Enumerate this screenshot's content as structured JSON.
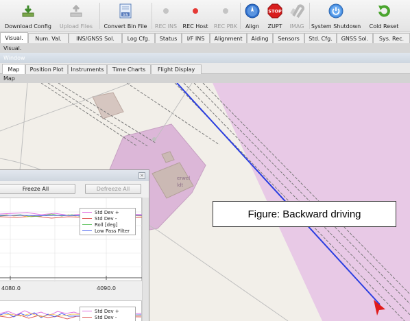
{
  "toolbar": {
    "buttons": [
      {
        "label": "Download Config",
        "icon": "download-icon",
        "enabled": true
      },
      {
        "label": "Upload Files",
        "icon": "upload-icon",
        "enabled": false
      },
      {
        "label": "Convert Bin File",
        "icon": "bin-file-icon",
        "enabled": true
      },
      {
        "label": "REC INS",
        "icon": "record-dot-icon",
        "enabled": false
      },
      {
        "label": "REC Host",
        "icon": "record-dot-icon",
        "enabled": true
      },
      {
        "label": "REC PBK",
        "icon": "record-dot-icon",
        "enabled": false
      },
      {
        "label": "Align",
        "icon": "compass-icon",
        "enabled": true
      },
      {
        "label": "ZUPT",
        "icon": "stop-sign-icon",
        "enabled": true
      },
      {
        "label": "IMAG",
        "icon": "magnet-icon",
        "enabled": false
      },
      {
        "label": "System Shutdown",
        "icon": "power-icon",
        "enabled": true
      },
      {
        "label": "Cold Reset",
        "icon": "reset-icon",
        "enabled": true
      }
    ],
    "stop_text": "STOP",
    "bin_text": "BIN"
  },
  "main_tabs": [
    "Visual.",
    "Num. Val.",
    "INS/GNSS Sol.",
    "Log Cfg.",
    "Status",
    "I/F INS",
    "Alignment",
    "Aiding",
    "Sensors",
    "Std. Cfg.",
    "GNSS Sol.",
    "Sys. Rec."
  ],
  "main_tab_active": "Visual.",
  "visual_strip": "Visual.",
  "window_strip": "Window",
  "sub_tabs": [
    "Map",
    "Position Plot",
    "Instruments",
    "Time Charts",
    "Flight Display"
  ],
  "sub_tab_active": "Map",
  "map_strip": "Map",
  "figure_caption": "Figure: Backward driving",
  "map_labels": {
    "building_text_1": "erwel",
    "building_text_2": "ldt"
  },
  "float_window": {
    "freeze_label": "Freeze All",
    "defreeze_label": "Defreeze All",
    "legend1": [
      {
        "name": "Std Dev +",
        "color": "#e070e0"
      },
      {
        "name": "Std Dev -",
        "color": "#e05a5a"
      },
      {
        "name": "Roll [deg]",
        "color": "#58c058"
      },
      {
        "name": "Low Pass Filter",
        "color": "#4a62ee"
      }
    ],
    "legend2": [
      {
        "name": "Std Dev +",
        "color": "#e070e0"
      },
      {
        "name": "Std Dev -",
        "color": "#e05a5a"
      }
    ],
    "x_ticks": [
      "4080.0",
      "4090.0"
    ]
  },
  "colors": {
    "track_line": "#2a3ee0",
    "vehicle_marker": "#e01b1b",
    "industrial_area": "#e8c9e6",
    "buildings": "#cbb9b4",
    "accent": "#3d78c8"
  }
}
